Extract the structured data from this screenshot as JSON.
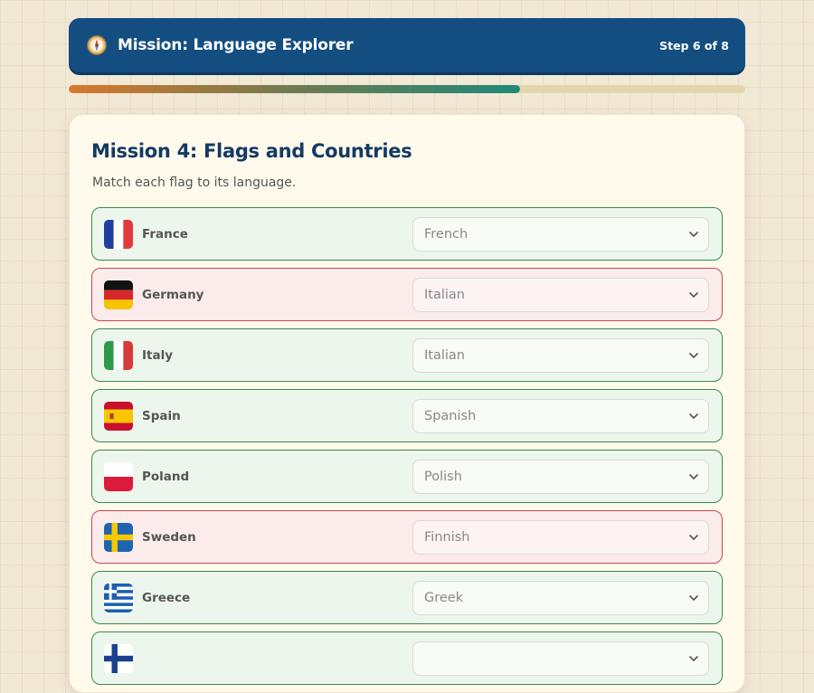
{
  "header": {
    "icon": "compass-icon",
    "title": "Mission: Language Explorer",
    "step": "Step 6 of 8"
  },
  "progress": {
    "fraction": 0.667,
    "colors": [
      "#d9782c",
      "#1f8a78"
    ]
  },
  "mission": {
    "title": "Mission 4: Flags and Countries",
    "instructions": "Match each flag to its language."
  },
  "rows": [
    {
      "country": "France",
      "flag": "france-flag-icon",
      "selected": "French",
      "status": "correct"
    },
    {
      "country": "Germany",
      "flag": "germany-flag-icon",
      "selected": "Italian",
      "status": "wrong"
    },
    {
      "country": "Italy",
      "flag": "italy-flag-icon",
      "selected": "Italian",
      "status": "correct"
    },
    {
      "country": "Spain",
      "flag": "spain-flag-icon",
      "selected": "Spanish",
      "status": "correct"
    },
    {
      "country": "Poland",
      "flag": "poland-flag-icon",
      "selected": "Polish",
      "status": "correct"
    },
    {
      "country": "Sweden",
      "flag": "sweden-flag-icon",
      "selected": "Finnish",
      "status": "wrong"
    },
    {
      "country": "Greece",
      "flag": "greece-flag-icon",
      "selected": "Greek",
      "status": "correct"
    },
    {
      "country": "",
      "flag": "finland-flag-icon",
      "selected": "",
      "status": "correct"
    }
  ],
  "colors": {
    "header": "#144e80",
    "correct": "#3a8a4a",
    "wrong": "#c6474c",
    "title": "#143a63"
  }
}
